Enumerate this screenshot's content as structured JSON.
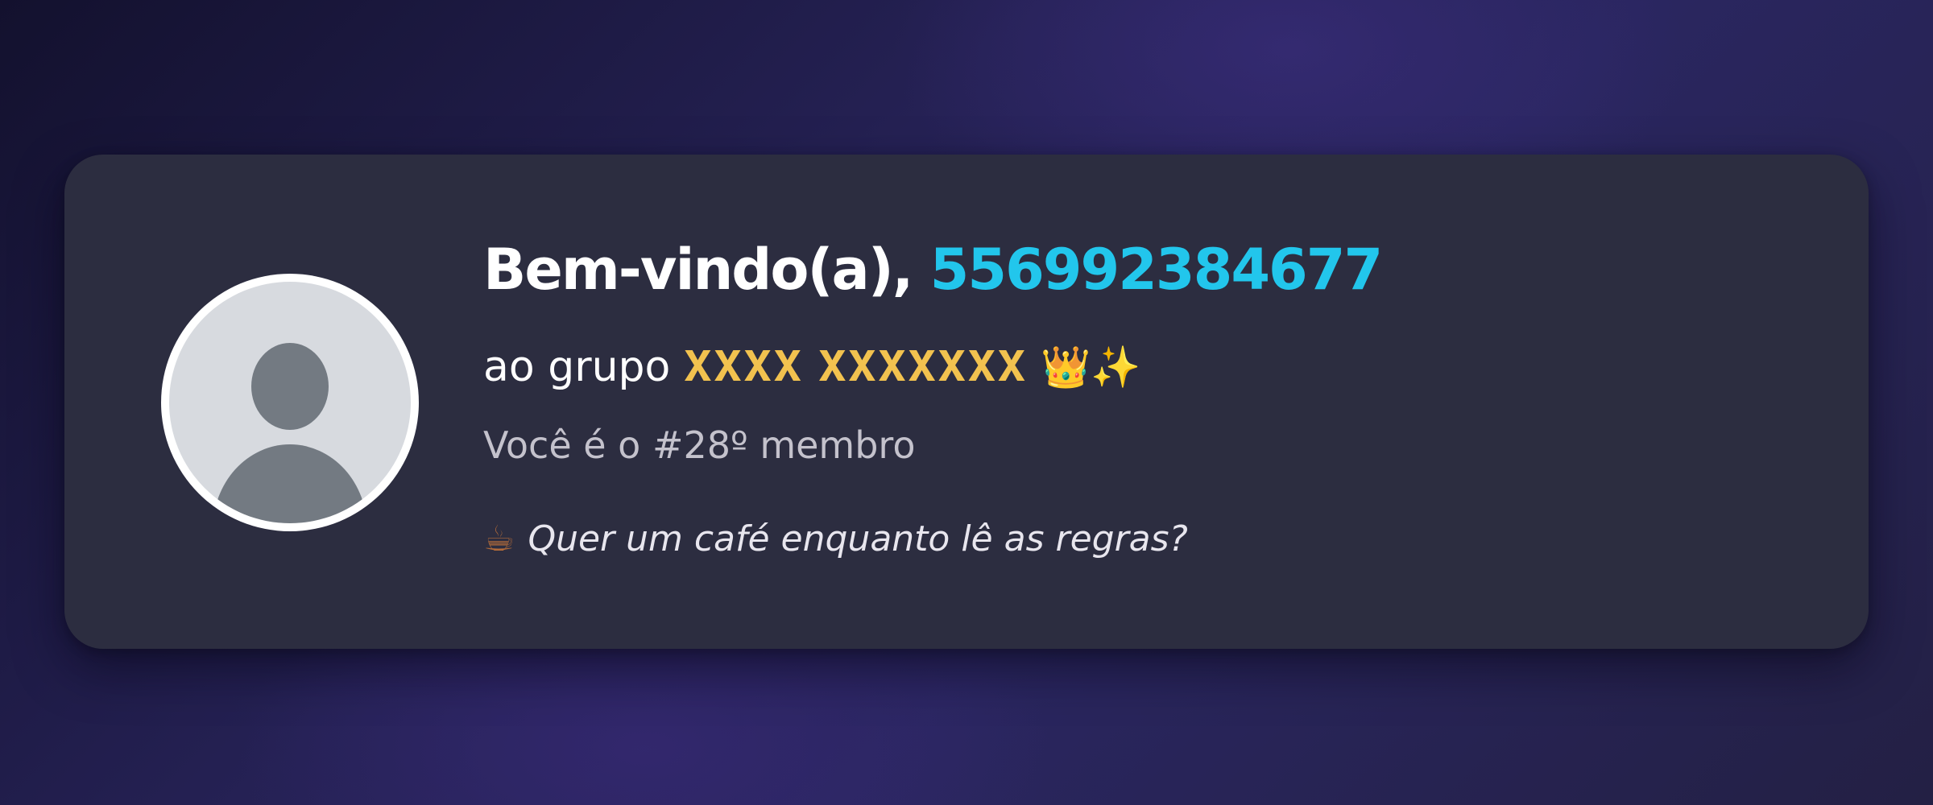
{
  "welcome": {
    "greeting": "Bem-vindo(a),",
    "username": "556992384677"
  },
  "group": {
    "prefix": "ao grupo",
    "name": "𝐗𝐗𝐗𝐗 𝐗𝐗𝐗𝐗𝐗𝐗𝐗",
    "emoji_crown": "👑",
    "emoji_sparkles": "✨"
  },
  "member": {
    "text": "Você é o #28º membro"
  },
  "tip": {
    "icon": "☕",
    "text": "Quer um café enquanto lê as regras?"
  },
  "colors": {
    "accent_username": "#22c6ec",
    "group_name": "#f2c24f",
    "card_bg": "#2c2d40"
  },
  "icons": {
    "avatar": "default-user-avatar-icon",
    "crown": "crown-icon",
    "sparkles": "sparkles-icon",
    "coffee": "coffee-icon"
  }
}
